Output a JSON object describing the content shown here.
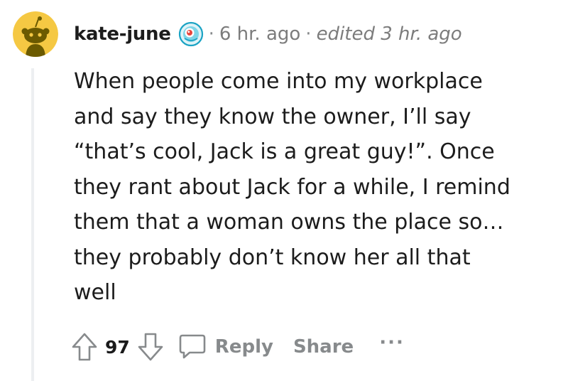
{
  "comment": {
    "author": "kate-june",
    "separator": "·",
    "time": "6 hr. ago",
    "edited": "edited 3 hr. ago",
    "avatar_icon": "snoo-avatar-icon",
    "flair_icon": "awardee-badge-icon",
    "body_lines": [
      "When people come into my workplace",
      "and say they know the owner, I’ll say",
      "“that’s cool, Jack is a great guy!”. Once",
      "they rant about Jack for a while, I remind",
      "them that a woman owns the place so…",
      "they probably don’t know her all that",
      "well"
    ]
  },
  "actions": {
    "score": "97",
    "reply_label": "Reply",
    "share_label": "Share",
    "more_label": "···",
    "upvote_icon": "upvote-arrow-icon",
    "downvote_icon": "downvote-arrow-icon",
    "reply_icon": "chat-bubble-icon"
  },
  "colors": {
    "avatar_bg": "#f5c843",
    "meta_gray": "#7c7c7c",
    "action_gray": "#878a8c",
    "thread_line": "#edeff1",
    "text": "#1c1c1c"
  }
}
